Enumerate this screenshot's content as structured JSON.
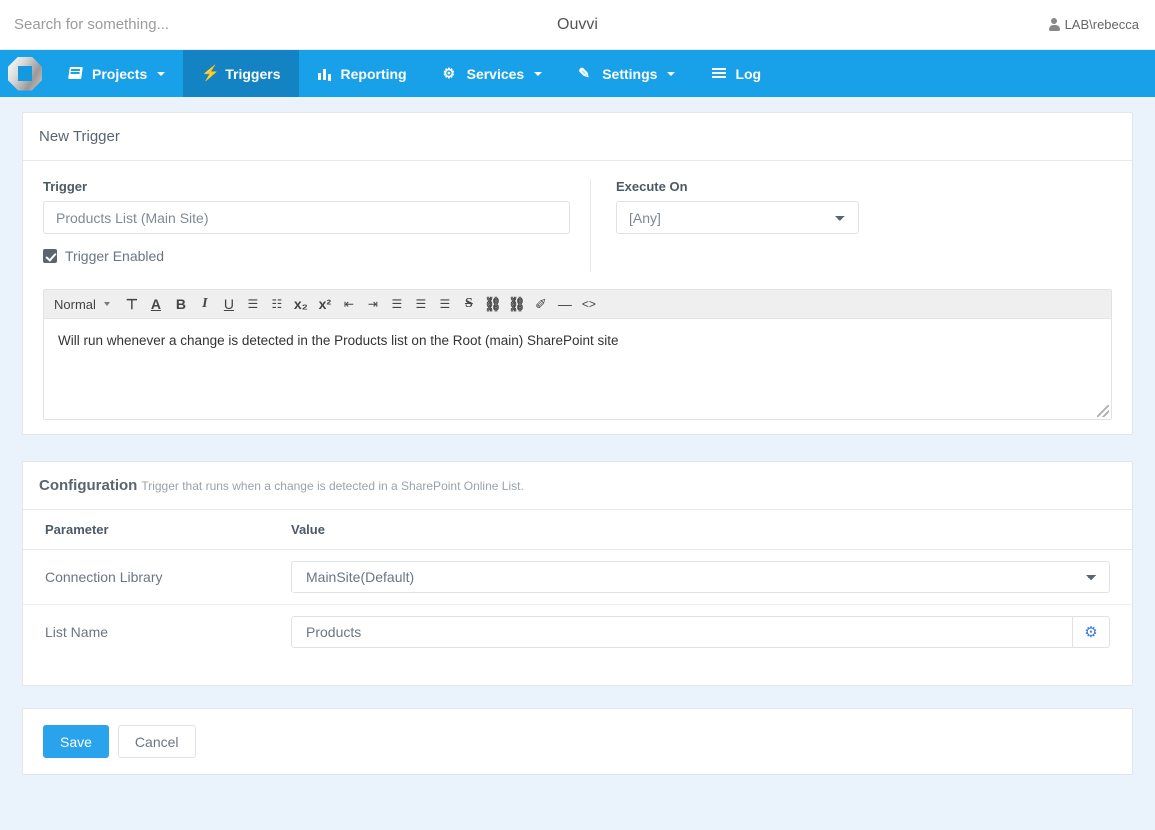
{
  "topbar": {
    "search_placeholder": "Search for something...",
    "search_value": "",
    "brand_title": "Ouvvi",
    "user_label": "LAB\\rebecca",
    "user_icon": "user-icon"
  },
  "navbar": {
    "logo_name": "ouvvi-logo",
    "accent_color": "#18a0e8",
    "active_color": "#1483c4",
    "items": [
      {
        "label": "Projects",
        "icon": "book-icon",
        "caret": true,
        "active": false
      },
      {
        "label": "Triggers",
        "icon": "bolt-icon",
        "caret": false,
        "active": true
      },
      {
        "label": "Reporting",
        "icon": "chart-icon",
        "caret": false,
        "active": false
      },
      {
        "label": "Services",
        "icon": "gears-icon",
        "caret": true,
        "active": false
      },
      {
        "label": "Settings",
        "icon": "wand-icon",
        "caret": true,
        "active": false
      },
      {
        "label": "Log",
        "icon": "list-icon",
        "caret": false,
        "active": false
      }
    ]
  },
  "trigger_panel": {
    "title": "New Trigger",
    "trigger_label": "Trigger",
    "trigger_value": "Products List (Main Site)",
    "trigger_enabled_label": "Trigger Enabled",
    "trigger_enabled_checked": true,
    "execute_on_label": "Execute On",
    "execute_on_value": "[Any]",
    "execute_on_options": [
      "[Any]"
    ]
  },
  "editor": {
    "style_picker": "Normal",
    "content": "Will run whenever a change is detected in the Products list on the Root (main) SharePoint site",
    "toolbar": [
      {
        "name": "font-size-icon",
        "glyph": "Ŧ"
      },
      {
        "name": "font-color-icon",
        "glyph": "A"
      },
      {
        "name": "bold-icon",
        "glyph": "B"
      },
      {
        "name": "italic-icon",
        "glyph": "I"
      },
      {
        "name": "underline-icon",
        "glyph": "U"
      },
      {
        "name": "ordered-list-icon",
        "glyph": "☰"
      },
      {
        "name": "bullet-list-icon",
        "glyph": "☰"
      },
      {
        "name": "subscript-icon",
        "glyph": "x₂"
      },
      {
        "name": "superscript-icon",
        "glyph": "x²"
      },
      {
        "name": "outdent-icon",
        "glyph": "≡"
      },
      {
        "name": "indent-icon",
        "glyph": "≡"
      },
      {
        "name": "align-left-icon",
        "glyph": "≡"
      },
      {
        "name": "align-center-icon",
        "glyph": "≡"
      },
      {
        "name": "align-right-icon",
        "glyph": "≡"
      },
      {
        "name": "strikethrough-icon",
        "glyph": "S"
      },
      {
        "name": "link-icon",
        "glyph": "⚭"
      },
      {
        "name": "unlink-icon",
        "glyph": "⚮"
      },
      {
        "name": "clear-format-icon",
        "glyph": "✐"
      },
      {
        "name": "horizontal-rule-icon",
        "glyph": "—"
      },
      {
        "name": "source-code-icon",
        "glyph": "<>"
      }
    ]
  },
  "configuration": {
    "title": "Configuration",
    "subtitle": "Trigger that runs when a change is detected in a SharePoint Online List.",
    "columns": [
      "Parameter",
      "Value"
    ],
    "rows": [
      {
        "parameter": "Connection Library",
        "type": "select",
        "value": "MainSite(Default)",
        "options": [
          "MainSite(Default)"
        ]
      },
      {
        "parameter": "List Name",
        "type": "input-with-button",
        "value": "Products",
        "button_icon": "gear-icon",
        "button_color": "#3b7dd8"
      }
    ]
  },
  "footer": {
    "save_label": "Save",
    "cancel_label": "Cancel"
  }
}
